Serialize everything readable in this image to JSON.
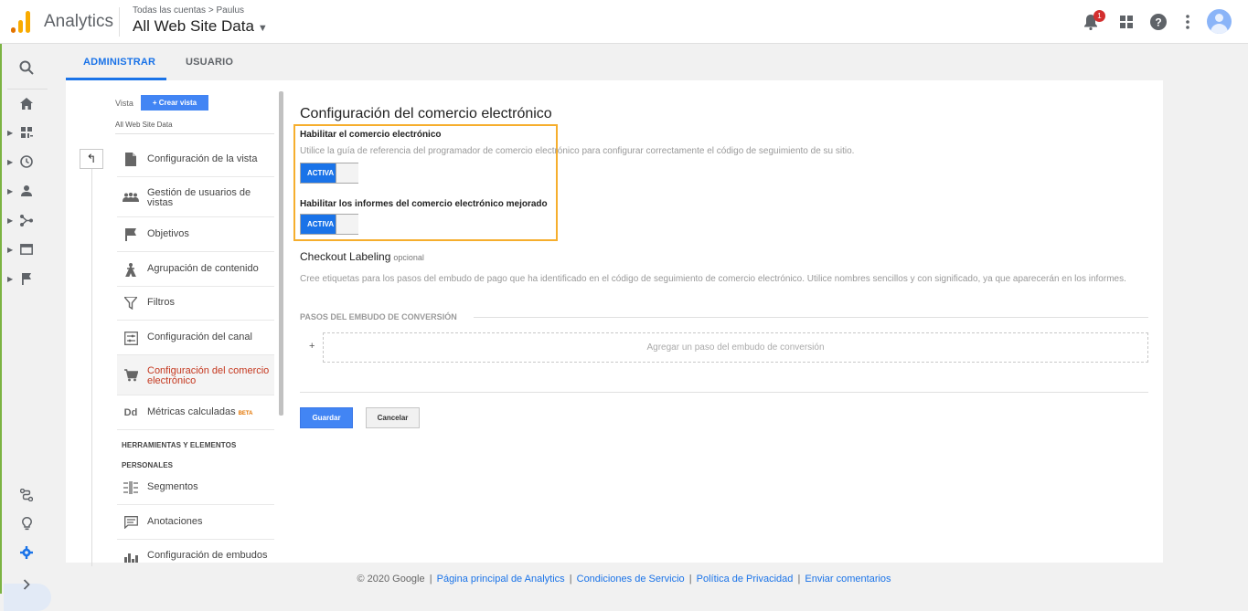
{
  "topbar": {
    "app_title": "Analytics",
    "breadcrumb_accounts": "Todas las cuentas",
    "breadcrumb_sep": ">",
    "breadcrumb_account": "Paulus",
    "view_name": "All Web Site Data",
    "notification_count": "1"
  },
  "tabs": {
    "admin": "ADMINISTRAR",
    "user": "USUARIO"
  },
  "sidebar": {
    "vista_label": "Vista",
    "create_view": "+ Crear vista",
    "view_name": "All Web Site Data",
    "items": [
      {
        "label": "Configuración de la vista"
      },
      {
        "label": "Gestión de usuarios de vistas"
      },
      {
        "label": "Objetivos"
      },
      {
        "label": "Agrupación de contenido"
      },
      {
        "label": "Filtros"
      },
      {
        "label": "Configuración del canal"
      },
      {
        "label": "Configuración del comercio electrónico"
      },
      {
        "label": "Métricas calculadas",
        "badge": "BETA"
      }
    ],
    "section_heading_1": "HERRAMIENTAS Y ELEMENTOS",
    "section_heading_2": "PERSONALES",
    "personal_items": [
      {
        "label": "Segmentos"
      },
      {
        "label": "Anotaciones"
      },
      {
        "label": "Configuración de embudos"
      }
    ]
  },
  "main": {
    "title": "Configuración del comercio electrónico",
    "ecommerce_label": "Habilitar el comercio electrónico",
    "ecommerce_hint": "Utilice la guía de referencia del programador de comercio electrónico para configurar correctamente el código de seguimiento de su sitio.",
    "ecommerce_toggle": "ACTIVA",
    "enhanced_label": "Habilitar los informes del comercio electrónico mejorado",
    "enhanced_toggle": "ACTIVA",
    "checkout_title": "Checkout Labeling",
    "checkout_optional": "opcional",
    "checkout_desc": "Cree etiquetas para los pasos del embudo de pago que ha identificado en el código de seguimiento de comercio electrónico. Utilice nombres sencillos y con significado, ya que aparecerán en los informes.",
    "funnel_heading": "PASOS DEL EMBUDO DE CONVERSIÓN",
    "add_step": "Agregar un paso del embudo de conversión",
    "save": "Guardar",
    "cancel": "Cancelar"
  },
  "footer": {
    "copyright": "© 2020 Google",
    "links": [
      "Página principal de Analytics",
      "Condiciones de Servicio",
      "Política de Privacidad",
      "Enviar comentarios"
    ],
    "separator": "|"
  },
  "colors": {
    "accent": "#1a73e8",
    "logo_orange": "#f9ab00",
    "logo_dark": "#e37400",
    "highlight_border": "#f6ae2d",
    "selected_text": "#c5381f"
  },
  "icons": [
    "search-icon",
    "home-icon",
    "dashboard-icon",
    "clock-icon",
    "person-icon",
    "acquisition-icon",
    "behavior-icon",
    "flag-icon",
    "attribution-icon",
    "lightbulb-icon",
    "gear-icon",
    "expand-icon",
    "bell-icon",
    "apps-icon",
    "help-icon",
    "more-icon",
    "avatar"
  ]
}
